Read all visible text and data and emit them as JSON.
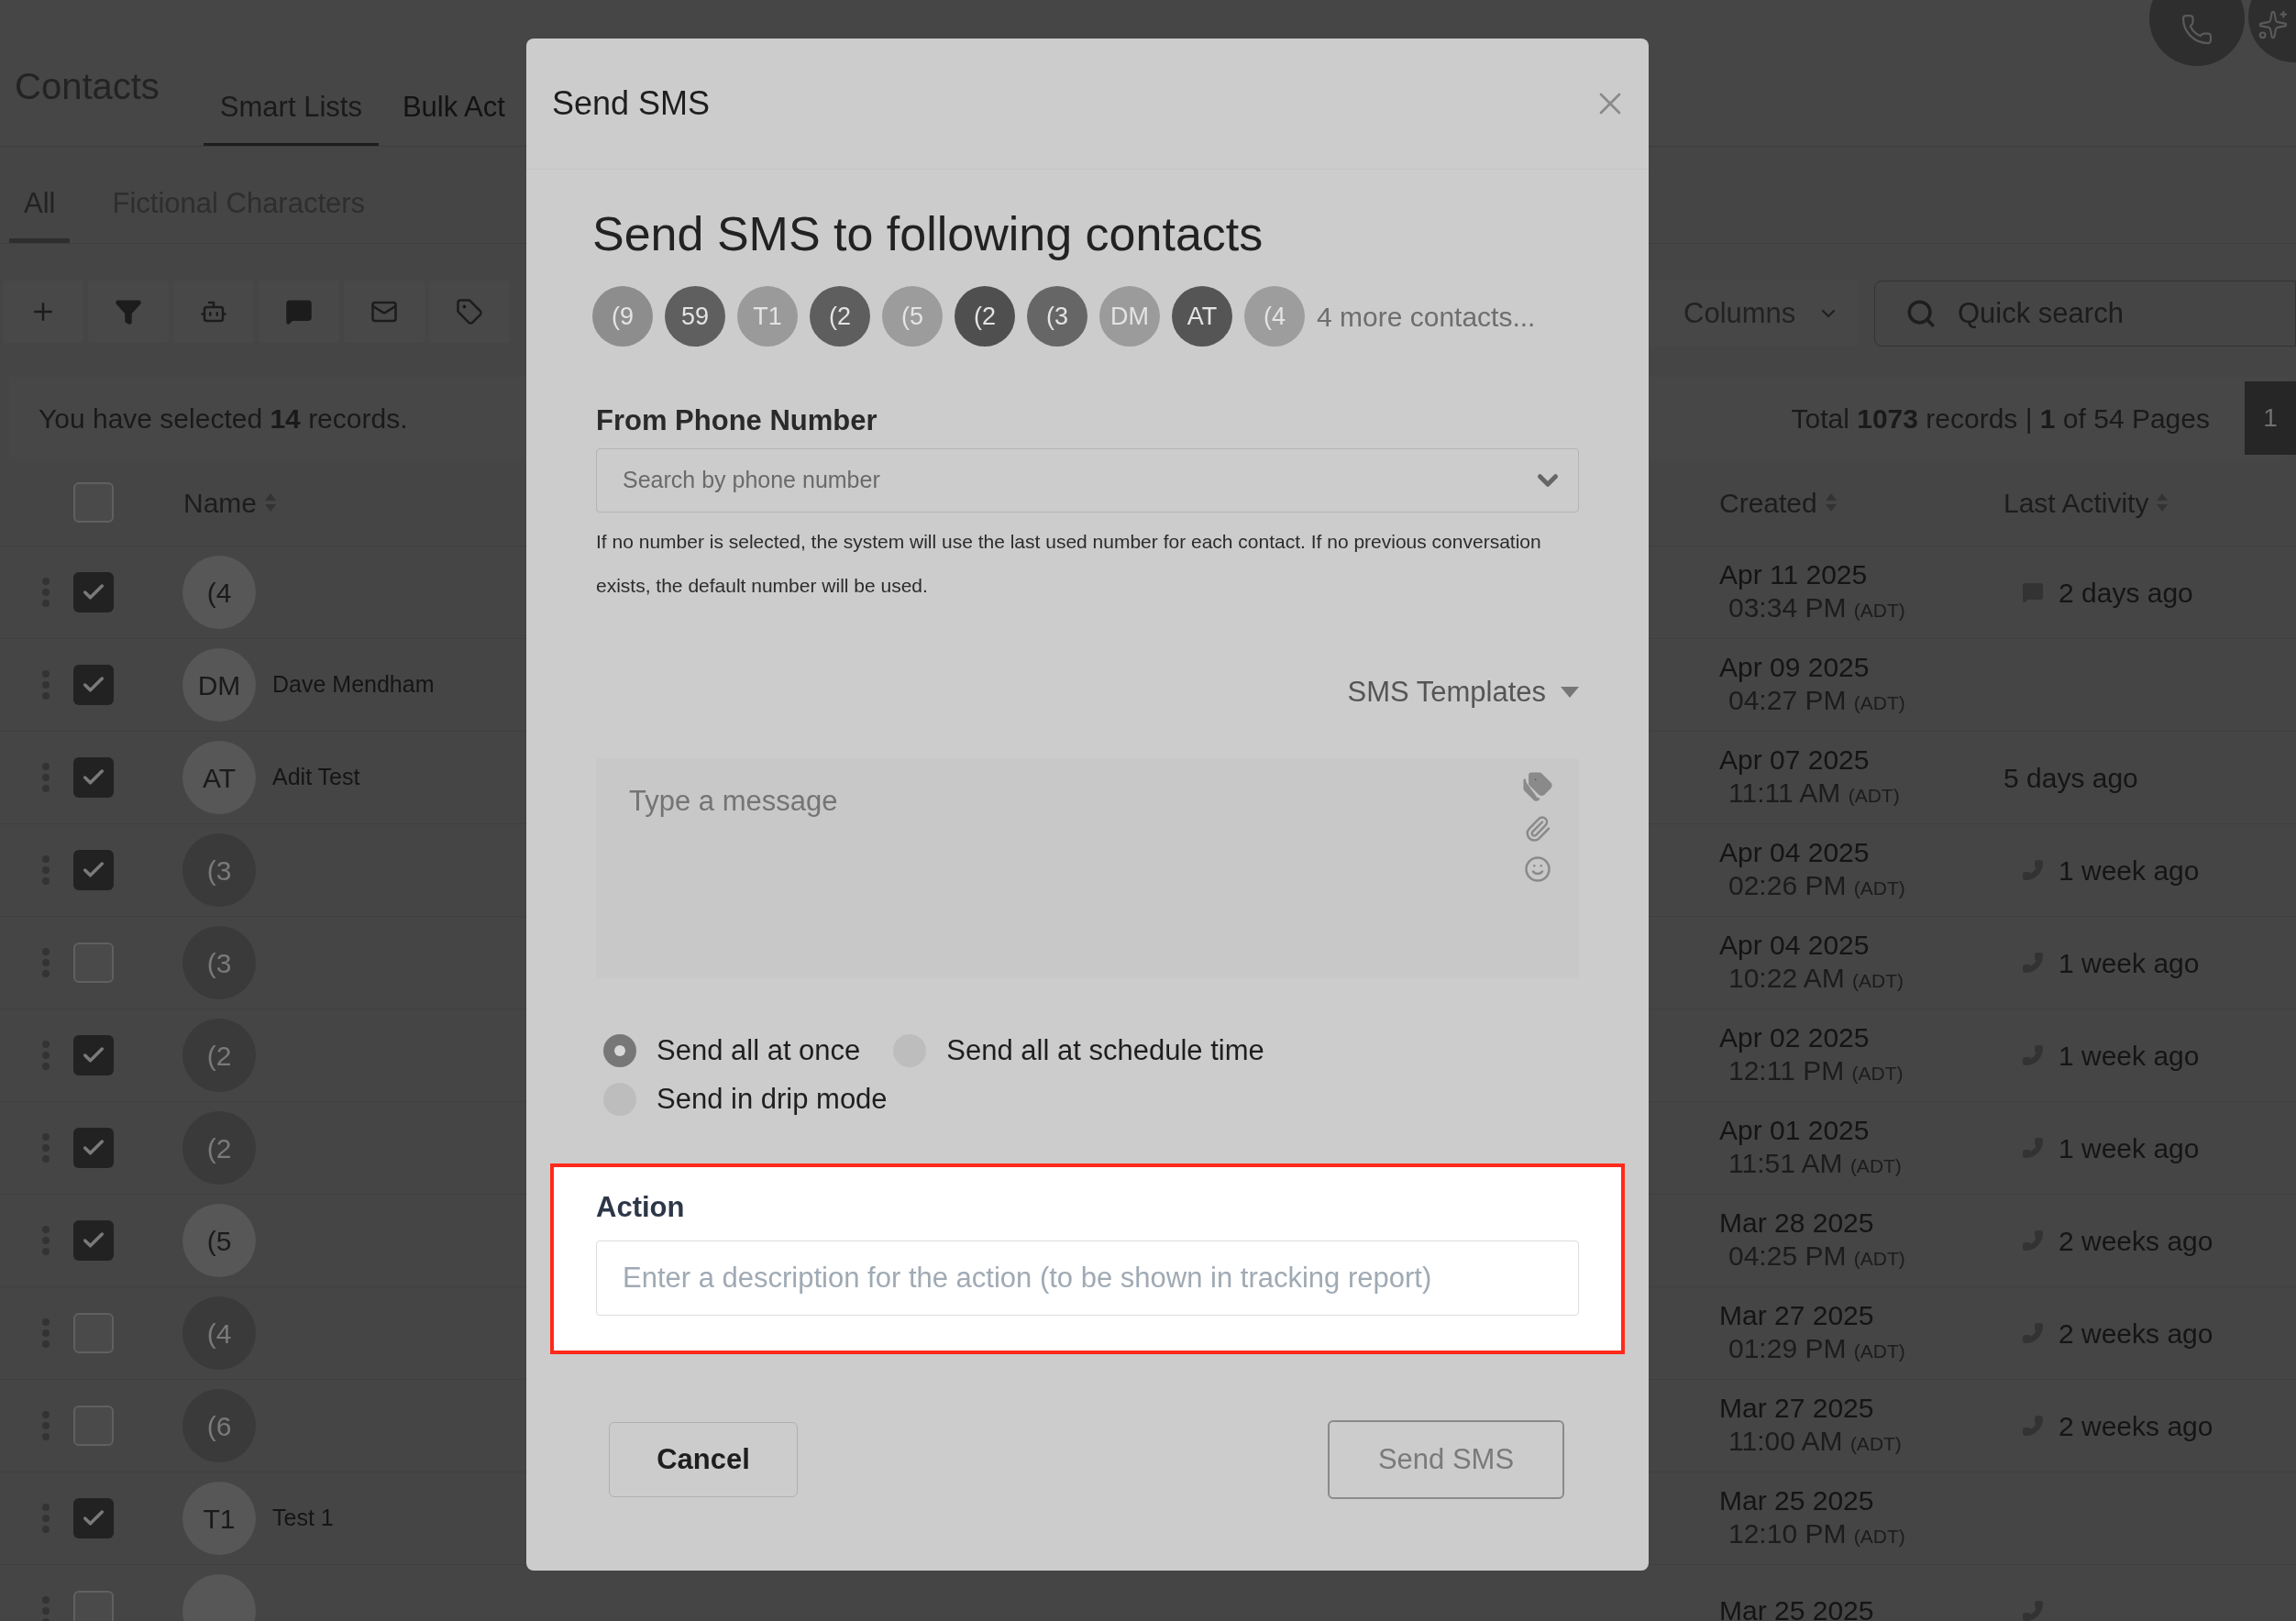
{
  "header": {
    "title": "Contacts",
    "tabs": [
      {
        "label": "Smart Lists",
        "selected": true
      },
      {
        "label": "Bulk Act",
        "selected": false
      }
    ]
  },
  "subtabs": [
    {
      "label": "All",
      "selected": true
    },
    {
      "label": "Fictional Characters",
      "selected": false
    }
  ],
  "toolbar": {
    "columns_button": "Columns",
    "search": {
      "placeholder": "Quick search"
    }
  },
  "selection_text": "You have selected **14** records.",
  "pagination": {
    "summary": "Total **1073** records | **1** of 54 Pages",
    "current_page": "1"
  },
  "table": {
    "columns": [
      "Name",
      "Created",
      "Last Activity"
    ],
    "select_all": false,
    "rows": [
      {
        "checked": true,
        "avatar": "(4",
        "color": "#575757",
        "date": "Apr 11 2025",
        "time": "03:34 PM",
        "zone": "(ADT)",
        "activity": {
          "kind": "message",
          "text": "2 days ago"
        }
      },
      {
        "checked": true,
        "avatar": "DM",
        "color": "#575757",
        "name": "Dave Mendham",
        "date": "Apr 09 2025",
        "time": "04:27 PM",
        "zone": "(ADT)"
      },
      {
        "checked": true,
        "avatar": "AT",
        "color": "#575757",
        "name": "Adit Test",
        "date": "Apr 07 2025",
        "time": "11:11 AM",
        "zone": "(ADT)",
        "activity": {
          "kind": "plain",
          "text": "5 days ago"
        }
      },
      {
        "checked": true,
        "avatar": "(3",
        "color": "#3a3a3a",
        "date": "Apr 04 2025",
        "time": "02:26 PM",
        "zone": "(ADT)",
        "activity": {
          "kind": "call",
          "text": "1 week ago"
        }
      },
      {
        "checked": false,
        "avatar": "(3",
        "color": "#3a3a3a",
        "date": "Apr 04 2025",
        "time": "10:22 AM",
        "zone": "(ADT)",
        "activity": {
          "kind": "call",
          "text": "1 week ago"
        }
      },
      {
        "checked": true,
        "avatar": "(2",
        "color": "#3a3a3a",
        "date": "Apr 02 2025",
        "time": "12:11 PM",
        "zone": "(ADT)",
        "activity": {
          "kind": "call",
          "text": "1 week ago"
        }
      },
      {
        "checked": true,
        "avatar": "(2",
        "color": "#3a3a3a",
        "date": "Apr 01 2025",
        "time": "11:51 AM",
        "zone": "(ADT)",
        "activity": {
          "kind": "call",
          "text": "1 week ago"
        }
      },
      {
        "checked": true,
        "avatar": "(5",
        "color": "#575757",
        "date": "Mar 28 2025",
        "time": "04:25 PM",
        "zone": "(ADT)",
        "activity": {
          "kind": "call",
          "text": "2 weeks ago"
        }
      },
      {
        "checked": false,
        "avatar": "(4",
        "color": "#3a3a3a",
        "date": "Mar 27 2025",
        "time": "01:29 PM",
        "zone": "(ADT)",
        "activity": {
          "kind": "call",
          "text": "2 weeks ago"
        }
      },
      {
        "checked": false,
        "avatar": "(6",
        "color": "#3a3a3a",
        "date": "Mar 27 2025",
        "time": "11:00 AM",
        "zone": "(ADT)",
        "activity": {
          "kind": "call",
          "text": "2 weeks ago"
        }
      },
      {
        "checked": true,
        "avatar": "T1",
        "color": "#575757",
        "name": "Test 1",
        "date": "Mar 25 2025",
        "time": "12:10 PM",
        "zone": "(ADT)"
      },
      {
        "checked": false,
        "color": "#575757",
        "date": "Mar 25 2025",
        "activity": {
          "kind": "call"
        }
      }
    ]
  },
  "modal": {
    "title": "Send SMS",
    "heading": "Send SMS to following contacts",
    "recipients": [
      {
        "label": "(9",
        "color": "#8d8d8d"
      },
      {
        "label": "59",
        "color": "#5f5f5f"
      },
      {
        "label": "T1",
        "color": "#9a9a9a"
      },
      {
        "label": "(2",
        "color": "#5e5e5e"
      },
      {
        "label": "(5",
        "color": "#9c9c9c"
      },
      {
        "label": "(2",
        "color": "#4f4f4f"
      },
      {
        "label": "(3",
        "color": "#666666"
      },
      {
        "label": "DM",
        "color": "#9b9b9b"
      },
      {
        "label": "AT",
        "color": "#555555"
      },
      {
        "label": "(4",
        "color": "#9d9d9d"
      }
    ],
    "more_contacts": "4 more contacts...",
    "from_label": "From Phone Number",
    "from_placeholder": "Search by phone number",
    "help": "If no number is selected, the system will use the last used number for each contact. If no previous conversation exists, the default number will be used.",
    "templates_label": "SMS Templates",
    "message_placeholder": "Type a message",
    "send_modes": [
      {
        "label": "Send all at once",
        "selected": true
      },
      {
        "label": "Send all at schedule time",
        "selected": false
      },
      {
        "label": "Send in drip mode",
        "selected": false
      }
    ],
    "action": {
      "label": "Action",
      "placeholder": "Enter a description for the action (to be shown in tracking report)"
    },
    "cancel_button": "Cancel",
    "submit_button": "Send SMS"
  }
}
